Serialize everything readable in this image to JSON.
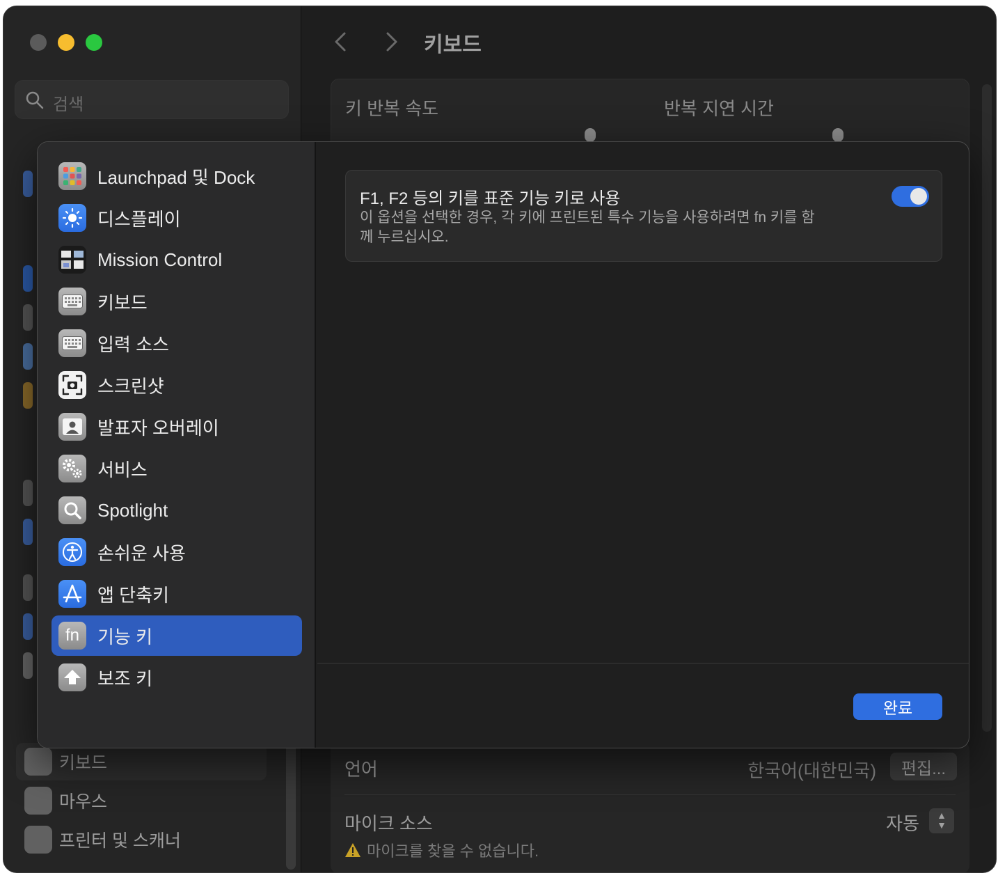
{
  "window": {
    "search_placeholder": "검색",
    "title": "키보드",
    "background_card": {
      "key_repeat_rate": "키 반복 속도",
      "delay_until_repeat": "반복 지연 시간"
    },
    "background_sidebar": [
      {
        "label": "키보드",
        "icon": "keyboard-icon",
        "selected": true
      },
      {
        "label": "마우스",
        "icon": "mouse-icon",
        "selected": false
      },
      {
        "label": "프린터 및 스캐너",
        "icon": "printer-icon",
        "selected": false
      }
    ],
    "language": {
      "label": "언어",
      "value": "한국어(대한민국)",
      "edit_button": "편집...",
      "mic_label": "마이크 소스",
      "mic_value": "자동",
      "mic_warning": "마이크를 찾을 수 없습니다."
    }
  },
  "sheet": {
    "sidebar": [
      {
        "label": "Launchpad 및 Dock",
        "icon": "launchpad-icon"
      },
      {
        "label": "디스플레이",
        "icon": "display-brightness-icon"
      },
      {
        "label": "Mission Control",
        "icon": "mission-control-icon"
      },
      {
        "label": "키보드",
        "icon": "keyboard-icon"
      },
      {
        "label": "입력 소스",
        "icon": "input-sources-icon"
      },
      {
        "label": "스크린샷",
        "icon": "screenshot-icon"
      },
      {
        "label": "발표자 오버레이",
        "icon": "presenter-overlay-icon"
      },
      {
        "label": "서비스",
        "icon": "services-gear-icon"
      },
      {
        "label": "Spotlight",
        "icon": "spotlight-icon"
      },
      {
        "label": "손쉬운 사용",
        "icon": "accessibility-icon"
      },
      {
        "label": "앱 단축키",
        "icon": "app-shortcuts-icon"
      },
      {
        "label": "기능 키",
        "icon": "fn-key-icon",
        "selected": true
      },
      {
        "label": "보조 키",
        "icon": "modifier-keys-icon"
      }
    ],
    "fn_icon_text": "fn",
    "option": {
      "title": "F1, F2 등의 키를 표준 기능 키로 사용",
      "description": "이 옵션을 선택한 경우, 각 키에 프린트된 특수 기능을 사용하려면 fn 키를 함께 누르십시오.",
      "enabled": true
    },
    "done_button": "완료"
  },
  "colors": {
    "accent": "#2f6ee0",
    "selection": "#2f5dbe",
    "window_bg": "#1e1e1e"
  }
}
